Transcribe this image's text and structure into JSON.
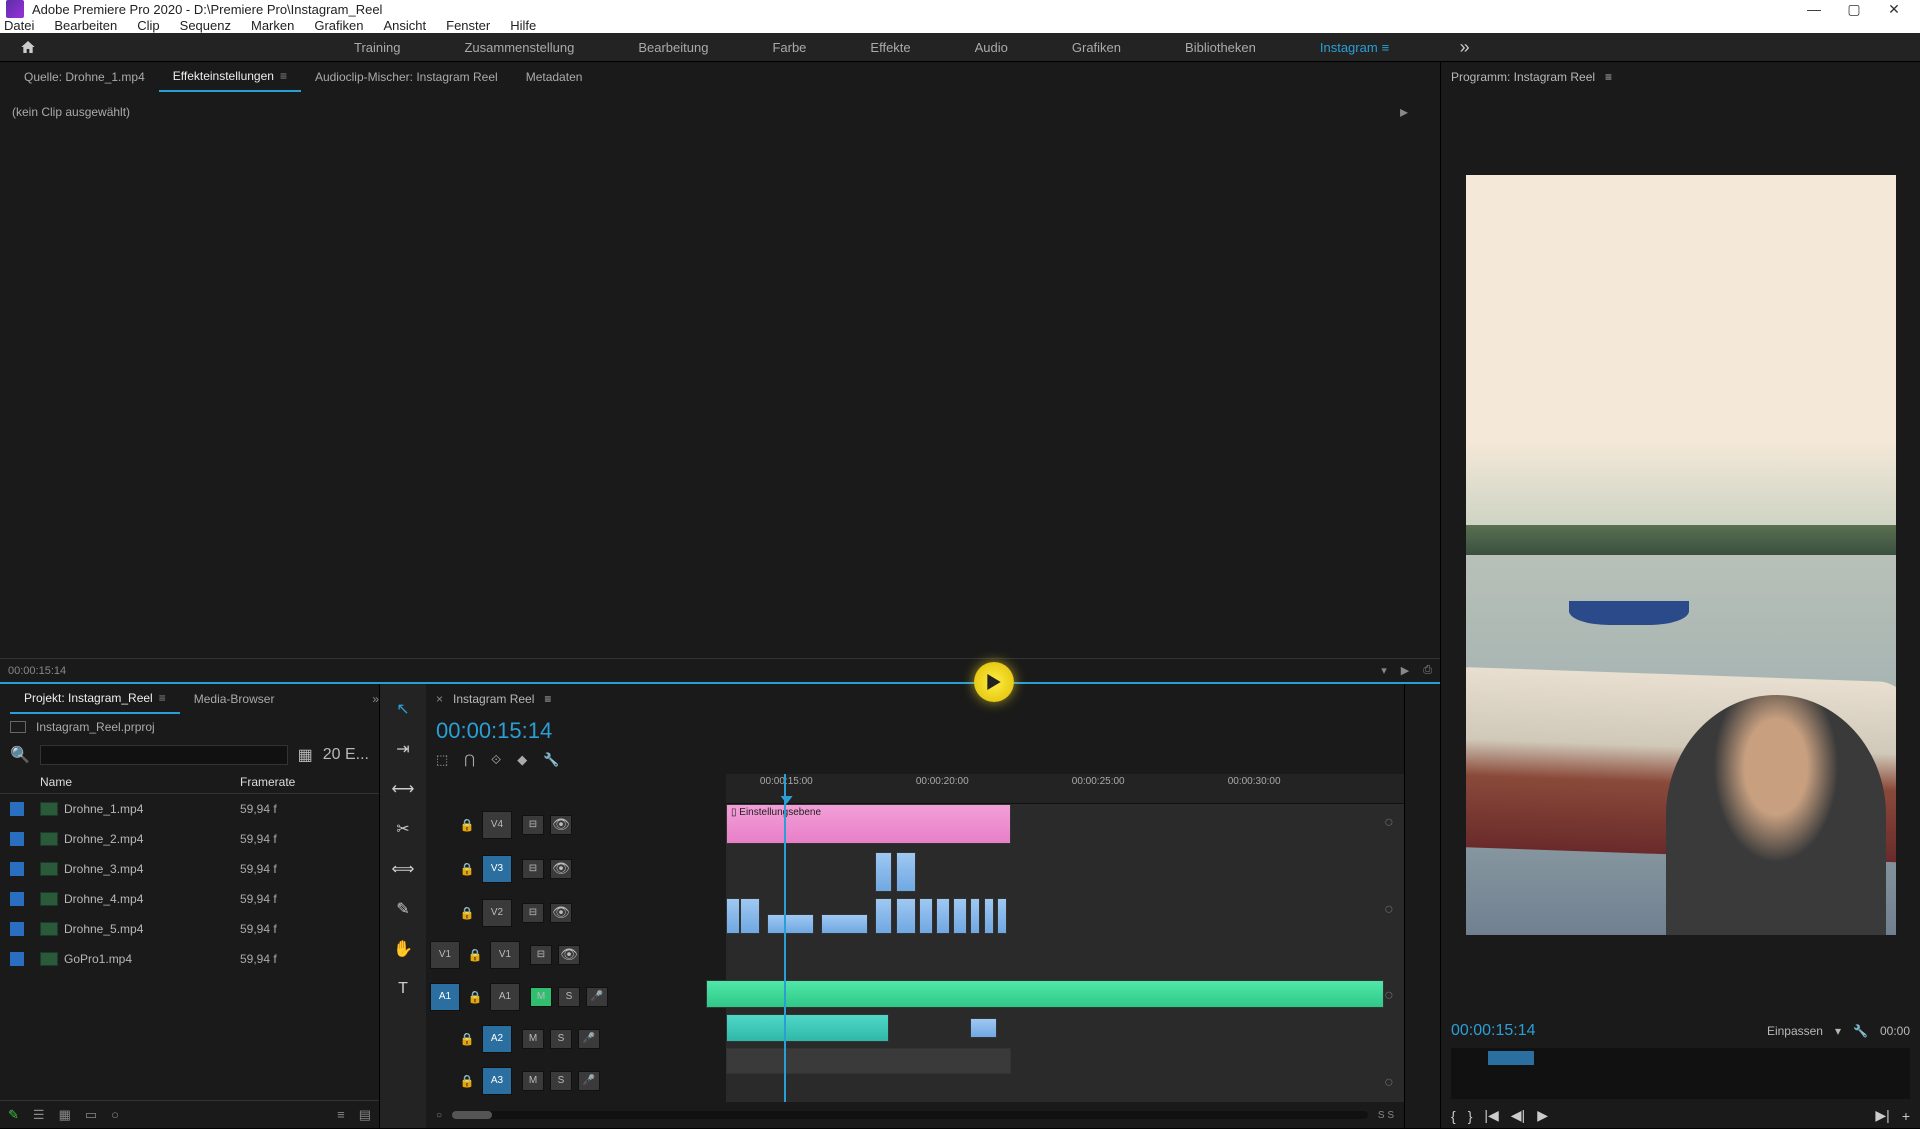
{
  "window": {
    "title": "Adobe Premiere Pro 2020 - D:\\Premiere Pro\\Instagram_Reel"
  },
  "menu": [
    "Datei",
    "Bearbeiten",
    "Clip",
    "Sequenz",
    "Marken",
    "Grafiken",
    "Ansicht",
    "Fenster",
    "Hilfe"
  ],
  "workspaces": {
    "items": [
      "Training",
      "Zusammenstellung",
      "Bearbeitung",
      "Farbe",
      "Effekte",
      "Audio",
      "Grafiken",
      "Bibliotheken",
      "Instagram"
    ],
    "active": "Instagram"
  },
  "sourceTabs": {
    "source": "Quelle: Drohne_1.mp4",
    "effect": "Effekteinstellungen",
    "audioMixer": "Audioclip-Mischer: Instagram Reel",
    "metadata": "Metadaten"
  },
  "effectPanel": {
    "noClip": "(kein Clip ausgewählt)",
    "footerTc": "00:00:15:14"
  },
  "project": {
    "tab": "Projekt: Instagram_Reel",
    "mediaBrowser": "Media-Browser",
    "fileName": "Instagram_Reel.prproj",
    "itemCount": "20 E...",
    "cols": {
      "name": "Name",
      "framerate": "Framerate"
    },
    "rows": [
      {
        "name": "Drohne_1.mp4",
        "fr": "59,94 f"
      },
      {
        "name": "Drohne_2.mp4",
        "fr": "59,94 f"
      },
      {
        "name": "Drohne_3.mp4",
        "fr": "59,94 f"
      },
      {
        "name": "Drohne_4.mp4",
        "fr": "59,94 f"
      },
      {
        "name": "Drohne_5.mp4",
        "fr": "59,94 f"
      },
      {
        "name": "GoPro1.mp4",
        "fr": "59,94 f"
      }
    ]
  },
  "timeline": {
    "seqName": "Instagram Reel",
    "timecode": "00:00:15:14",
    "ruler": [
      "00:00:15:00",
      "00:00:20:00",
      "00:00:25:00",
      "00:00:30:00"
    ],
    "adjLayer": "Einstellungsebene",
    "trackLabels": {
      "V4": "V4",
      "V3": "V3",
      "V2": "V2",
      "V1": "V1",
      "A1": "A1",
      "A2": "A2",
      "A3": "A3"
    },
    "ms": {
      "M": "M",
      "S": "S"
    },
    "ss": "S S"
  },
  "program": {
    "title": "Programm: Instagram Reel",
    "tc": "00:00:15:14",
    "fit": "Einpassen",
    "dur": "00:00"
  }
}
